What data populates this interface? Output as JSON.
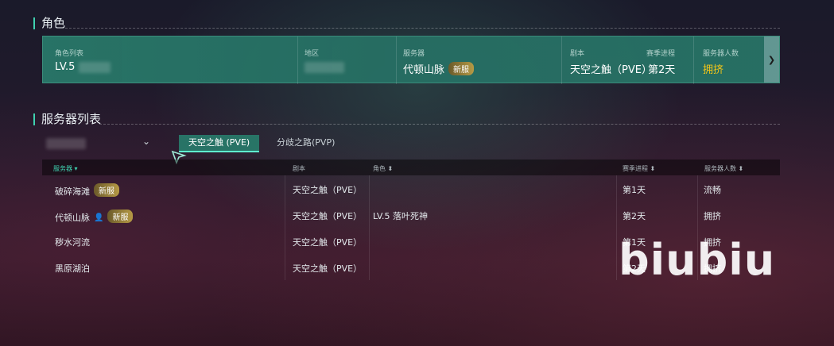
{
  "role_section": {
    "title": "角色"
  },
  "role_card": {
    "role_list_label": "角色列表",
    "role_level": "LV.5",
    "region_label": "地区",
    "server_label": "服务器",
    "server_value": "代顿山脉",
    "server_badge": "新服",
    "instance_label": "剧本",
    "instance_value": "天空之触（PVE）",
    "season_label": "赛季进程",
    "season_value": "第2天",
    "population_label": "服务器人数",
    "population_value": "拥挤",
    "expand_icon": "chevron-down-icon"
  },
  "server_section": {
    "title": "服务器列表"
  },
  "filters": {
    "tabs": [
      "天空之触 (PVE)",
      "分歧之路(PVP)"
    ],
    "active_tab": 0
  },
  "table": {
    "headers": [
      "服务器",
      "剧本",
      "角色",
      "赛季进程",
      "服务器人数"
    ],
    "rows": [
      {
        "server": "破碎海滩",
        "badge": "新服",
        "has_role_icon": false,
        "instance": "天空之触（PVE）",
        "role": "",
        "season": "第1天",
        "population": "流畅",
        "status": "smooth"
      },
      {
        "server": "代顿山脉",
        "badge": "新服",
        "has_role_icon": true,
        "instance": "天空之触（PVE）",
        "role": "LV.5 落叶死神",
        "season": "第2天",
        "population": "拥挤",
        "status": "crowded"
      },
      {
        "server": "秽水河流",
        "badge": "",
        "has_role_icon": false,
        "instance": "天空之触（PVE）",
        "role": "",
        "season": "第1天",
        "population": "拥挤",
        "status": "crowded"
      },
      {
        "server": "黑原湖泊",
        "badge": "",
        "has_role_icon": false,
        "instance": "天空之触（PVE）",
        "role": "",
        "season": "第2天",
        "population": "拥挤",
        "status": "crowded"
      }
    ]
  },
  "watermark": "biubiu",
  "colors": {
    "accent": "#3fd1b0",
    "crowded": "#f0c419",
    "smooth": "#3fd17a"
  }
}
